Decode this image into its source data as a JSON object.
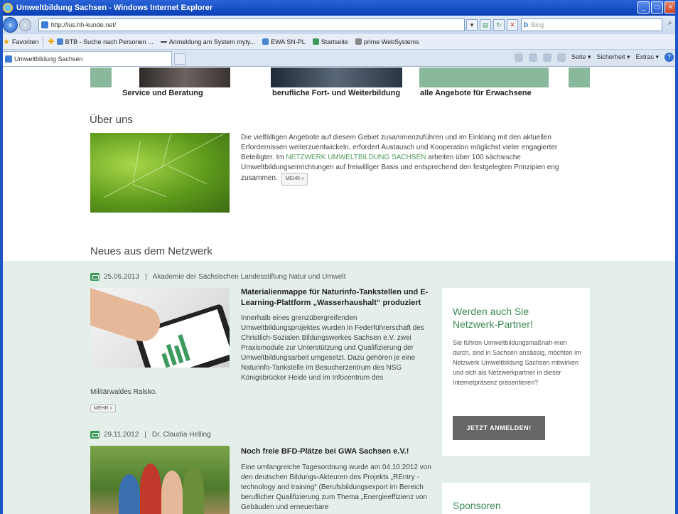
{
  "window": {
    "title": "Umweltbildung Sachsen - Windows Internet Explorer",
    "buttons": [
      "_",
      "□",
      "×"
    ]
  },
  "address_bar": {
    "url": "http://ius.hh-kunde.net/",
    "search_placeholder": "Bing",
    "search_engine": "b"
  },
  "favorites": {
    "label": "Favoriten",
    "items": [
      "BTB - Suche nach Personen ...",
      "Anmeldung am System myty...",
      "EWA SN-PL",
      "Startseite",
      "prime WebSystems"
    ]
  },
  "tabs": {
    "active": "Umweltbildung Sachsen"
  },
  "command_bar": {
    "seite": "Seite ▾",
    "sicherheit": "Sicherheit ▾",
    "extras": "Extras ▾"
  },
  "banners": {
    "labels": [
      "Service und Beratung",
      "berufliche Fort- und Weiterbildung",
      "alle Angebote für Erwachsene"
    ]
  },
  "about": {
    "heading": "Über uns",
    "text_1": "Die vielfältigen Angebote auf diesem Gebiet zusammenzuführen und im Einklang mit den aktuellen Erfordernissen weiterzuentwickeln, erfordert Austausch und Kooperation möglichst vieler engagierter Beteiligter. Im ",
    "link": "NETZWERK UMWELTBILDUNG SACHSEN",
    "text_2": " arbeiten über 100 sächsische Umweltbildungseinrichtungen auf freiwilliger Basis und entsprechend den festgelegten Prinzipien eng zusammen.",
    "more": "MEHR »"
  },
  "news": {
    "heading": "Neues aus dem Netzwerk",
    "items": [
      {
        "date": "25.06.2013",
        "source": "Akademie der Sächsischen Landesstiftung Natur und Umwelt",
        "title": "Materialienmappe für Naturinfo-Tankstellen und E-Learning-Plattform „Wasserhaushalt“ produziert",
        "body": "Innerhalb eines grenzübergreifenden Umweltbildungsprojektes wurden in Federführerschaft des Christlich-Sozialen Bildungswerkes Sachsen e.V. zwei Praxismodule zur Unterstützung und Qualifizierung der Umweltbildungsarbeit umgesetzt. Dazu gehören je eine Naturinfo-Tankstelle im Besucherzentrum des NSG Königsbrücker Heide und im Infocentrum des",
        "body_cont": "Militärwaldes Ralsko.",
        "more": "MEHR »"
      },
      {
        "date": "29.11.2012",
        "source": "Dr. Claudia Helling",
        "title": "Noch freie BFD-Plätze bei GWA Sachsen e.V.!",
        "body": "Eine umfangreiche Tagesordnung wurde am 04.10.2012 von den deutschen Bildungs-Akteuren des Projekts „REntry - technology and training“ (Berufsbildungsexport im Bereich beruflicher Qualifizierung zum Thema „Energieeffizienz von Gebäuden und erneuerbare"
      }
    ],
    "separator": "|"
  },
  "partner": {
    "title": "Werden auch Sie Netzwerk-Partner!",
    "text": "Sie führen Umweltbildungsmaßnah-men durch, sind in Sachsen ansässig, möchten im Netzwerk Umweltbildung Sachsen mitwirken und sich als Netzwerkpartner in dieser Internetpräsenz präsentieren?",
    "button": "JETZT ANMELDEN!"
  },
  "sponsors": {
    "title": "Sponsoren"
  },
  "colors": {
    "accent_green": "#3c8a55",
    "news_bg": "#e5efe9",
    "ie_blue": "#1e55c4"
  }
}
